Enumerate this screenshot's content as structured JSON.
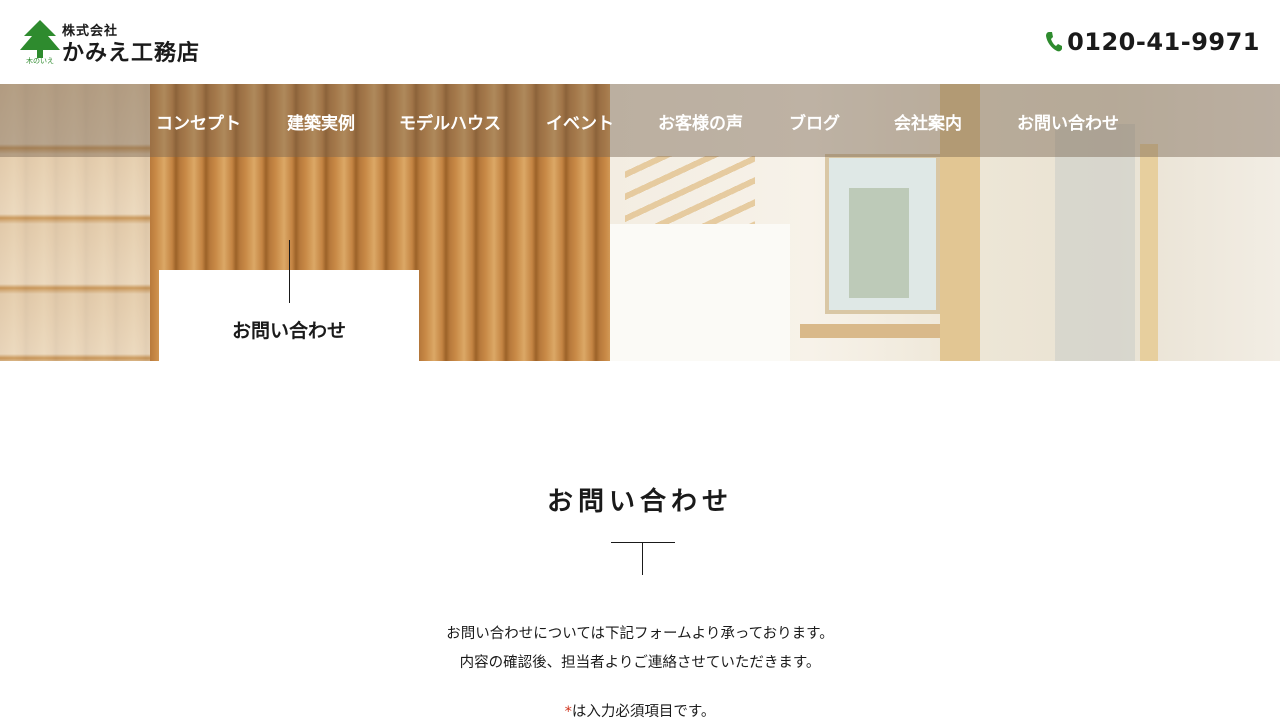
{
  "header": {
    "logo": {
      "tagline": "木のいえ",
      "company_type": "株式会社",
      "name": "かみえ工務店",
      "icon": "tree-icon",
      "accent_color": "#2e8b2e"
    },
    "phone": {
      "icon": "phone-icon",
      "number": "0120-41-9971",
      "icon_color": "#2e8b2e"
    }
  },
  "nav": {
    "items": [
      {
        "label": "コンセプト"
      },
      {
        "label": "建築実例"
      },
      {
        "label": "モデルハウス"
      },
      {
        "label": "イベント"
      },
      {
        "label": "お客様の声"
      },
      {
        "label": "ブログ"
      },
      {
        "label": "会社案内"
      },
      {
        "label": "お問い合わせ"
      }
    ]
  },
  "hero": {
    "page_label": "お問い合わせ"
  },
  "main": {
    "title": "お問い合わせ",
    "intro_lines": [
      "お問い合わせについては下記フォームより承っております。",
      "内容の確認後、担当者よりご連絡させていただきます。"
    ],
    "required_mark": "*",
    "required_note": "は入力必須項目です。",
    "required_color": "#d0331c"
  }
}
